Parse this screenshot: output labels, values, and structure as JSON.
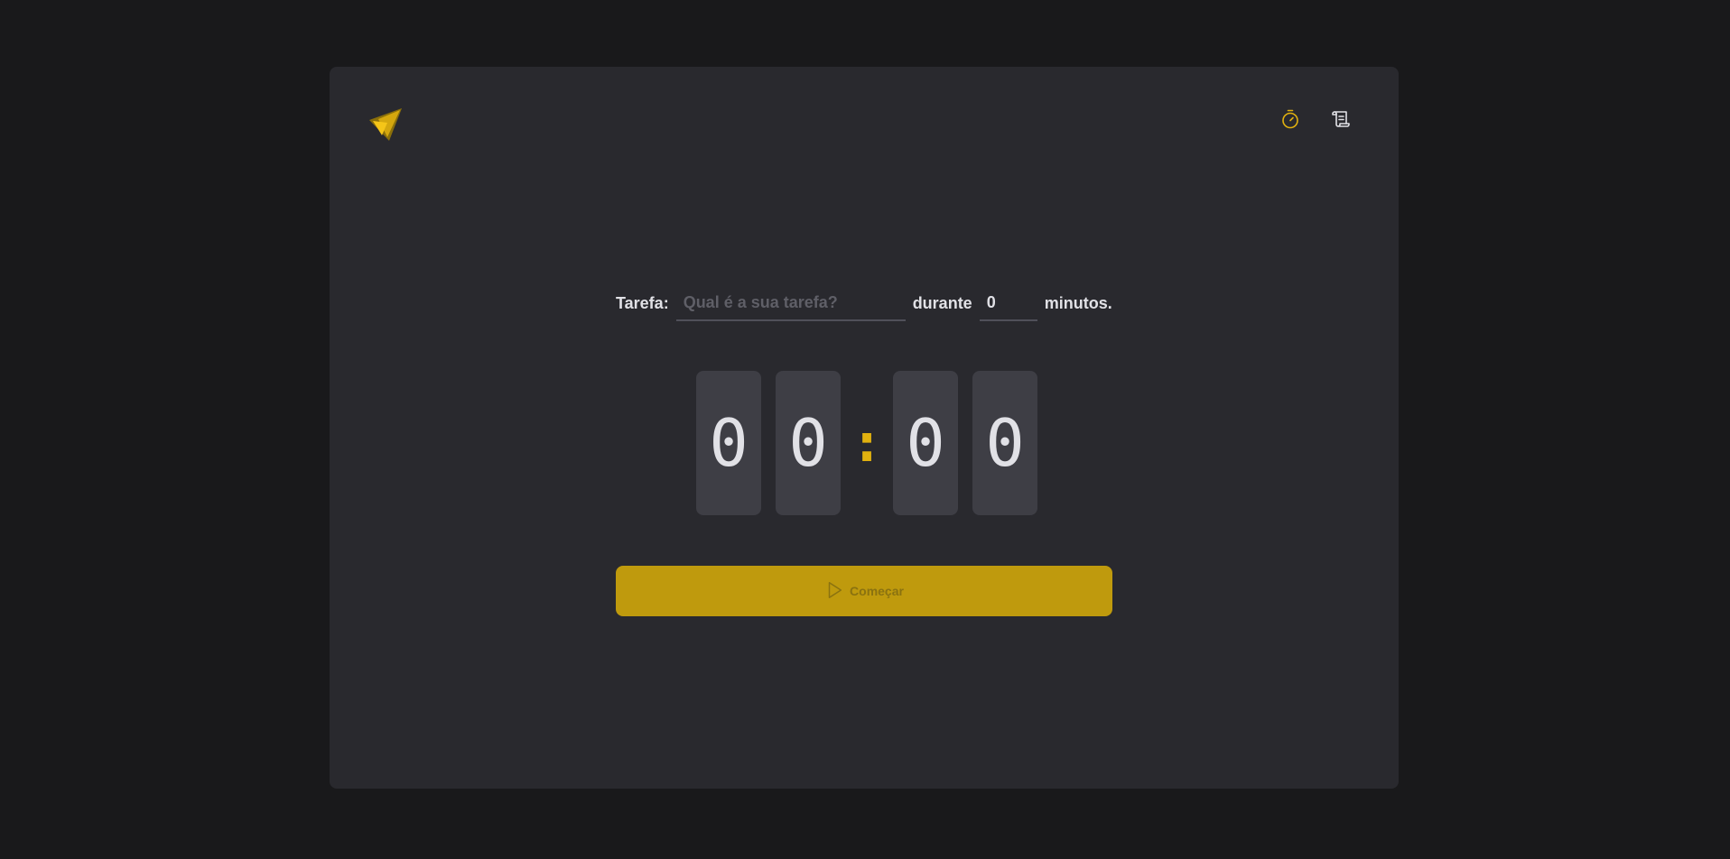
{
  "header": {
    "logo_icon": "triangle-logo-icon",
    "nav": [
      {
        "icon": "timer-icon",
        "active": true
      },
      {
        "icon": "scroll-history-icon",
        "active": false
      }
    ]
  },
  "form": {
    "task_label": "Tarefa:",
    "task_placeholder": "Qual é a sua tarefa?",
    "task_value": "",
    "during_label": "durante",
    "minutes_value": "0",
    "minutes_suffix": "minutos."
  },
  "countdown": {
    "digits": [
      "0",
      "0",
      "0",
      "0"
    ],
    "separator": ":"
  },
  "start_button": {
    "label": "Começar",
    "icon": "play-icon",
    "disabled": true
  },
  "colors": {
    "background": "#19191b",
    "card": "#29292e",
    "digit_bg": "#3e3e45",
    "accent": "#e1b10f",
    "button": "#bf9a0d",
    "text": "#e1e1e6"
  }
}
